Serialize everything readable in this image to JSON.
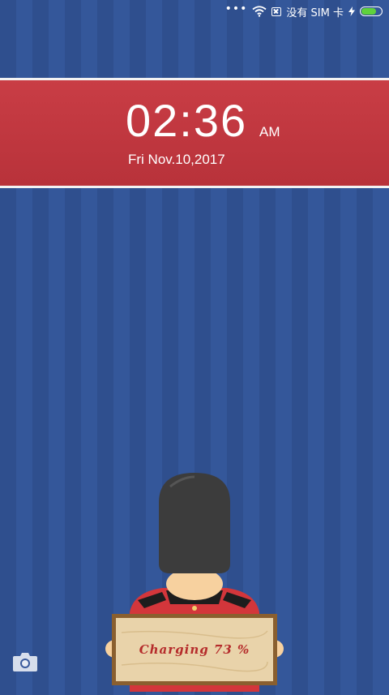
{
  "status_bar": {
    "dots": "•••",
    "wifi_icon": "wifi-icon",
    "no_sim_icon": "sim-missing-icon",
    "carrier_text": "没有 SIM 卡",
    "charging_icon": "lightning-icon",
    "battery_level": 0.73,
    "battery_color": "#5fd13c"
  },
  "clock": {
    "time": "02:36",
    "ampm": "AM",
    "date": "Fri Nov.10,2017"
  },
  "banner_color": "#c93d45",
  "guard_sign": {
    "text": "Charging 73 %"
  },
  "camera_shortcut": {
    "icon": "camera-icon"
  }
}
